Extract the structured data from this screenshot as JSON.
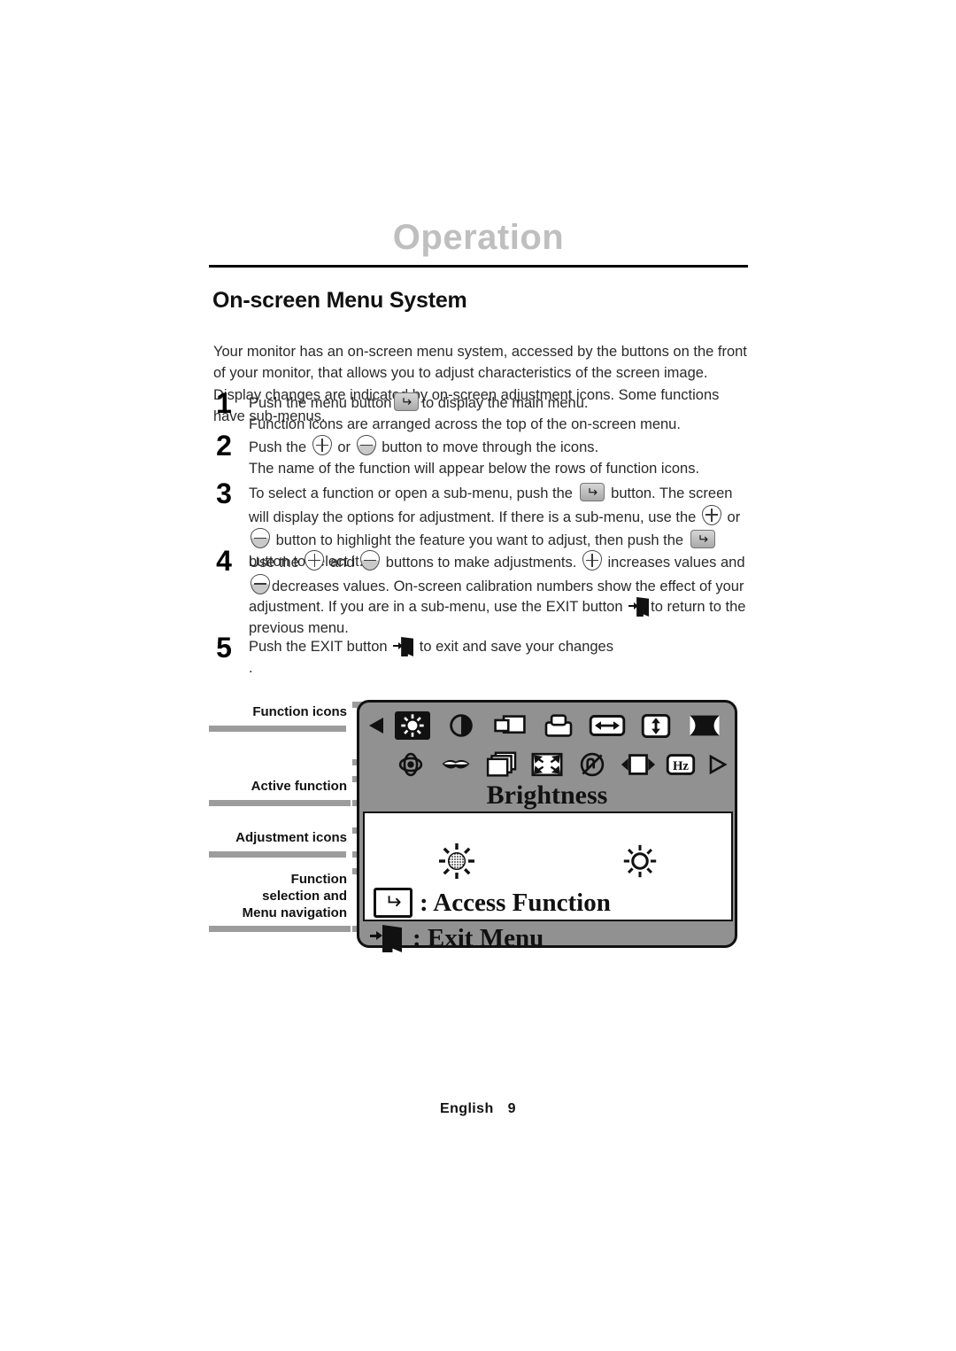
{
  "chapter": {
    "title": "Operation"
  },
  "section": {
    "title": "On-screen Menu System"
  },
  "intro": "Your monitor has an on-screen menu system, accessed by the buttons on the front of your monitor, that allows you to adjust characteristics of the screen image. Display changes are indicated by on-screen adjustment icons. Some functions have sub-menus.",
  "steps": [
    {
      "number": "1",
      "part_a": "Push the menu button",
      "part_b": "to display the main menu.",
      "line2": "Function icons are arranged across the top of the on-screen menu."
    },
    {
      "number": "2",
      "part_a": "Push the",
      "part_b": "or",
      "part_c": "button to move through the icons.",
      "line2": "The name of the function will appear below the rows of function icons."
    },
    {
      "number": "3",
      "part_a": "To select a function or open a sub-menu, push the",
      "part_b": "button. The screen will display the options for adjustment. If there is a sub-menu, use the",
      "part_c": "or",
      "part_d": "button to highlight the feature you want to adjust, then push the",
      "part_e": "button to select it."
    },
    {
      "number": "4",
      "part_a": "Use the",
      "part_b": "and",
      "part_c": "buttons to make adjustments.",
      "part_d": "increases values and",
      "part_e": "decreases values. On-screen calibration numbers show the effect of your adjustment. If you are in a sub-menu, use the EXIT button",
      "part_f": "to return to the previous menu."
    },
    {
      "number": "5",
      "part_a": "Push the EXIT button",
      "part_b": "to exit and save your changes",
      "line2": "."
    }
  ],
  "callouts": [
    {
      "label": "Function icons"
    },
    {
      "label": "Active function"
    },
    {
      "label": "Adjustment icons"
    },
    {
      "label_line1": "Function",
      "label_line2": "selection and",
      "label_line3": "Menu navigation"
    }
  ],
  "osd": {
    "active_function": "Brightness",
    "access_function_text": ": Access Function",
    "exit_menu_text": ": Exit Menu",
    "colors": {
      "panel_background": "#919191",
      "panel_border": "#111111",
      "adjust_background": "#ffffff",
      "selected_icon_background": "#111111",
      "callout_bar": "#9c9c9c",
      "chapter_title": "#bfbfbf"
    },
    "nav_left_icon": "triangle-left-icon",
    "nav_right_icon": "triangle-right-icon",
    "function_icons_row1": [
      {
        "name": "brightness-icon",
        "selected": true
      },
      {
        "name": "contrast-icon",
        "selected": false
      },
      {
        "name": "horizontal-position-icon",
        "selected": false
      },
      {
        "name": "vertical-position-icon",
        "selected": false
      },
      {
        "name": "horizontal-size-icon",
        "selected": false
      },
      {
        "name": "vertical-size-icon",
        "selected": false
      },
      {
        "name": "pincushion-icon",
        "selected": false
      }
    ],
    "function_icons_row2": [
      {
        "name": "rotation-icon",
        "selected": false
      },
      {
        "name": "trapezoid-icon",
        "selected": false
      },
      {
        "name": "parallelogram-icon",
        "selected": false
      },
      {
        "name": "corner-correction-icon",
        "selected": false
      },
      {
        "name": "degauss-icon",
        "selected": false
      },
      {
        "name": "moire-icon",
        "selected": false
      },
      {
        "name": "frequency-hz-icon",
        "selected": false
      }
    ],
    "adjustment_icons": [
      {
        "name": "brightness-decrease-icon"
      },
      {
        "name": "brightness-increase-icon"
      }
    ]
  },
  "footer": {
    "language": "English",
    "page": "9"
  }
}
